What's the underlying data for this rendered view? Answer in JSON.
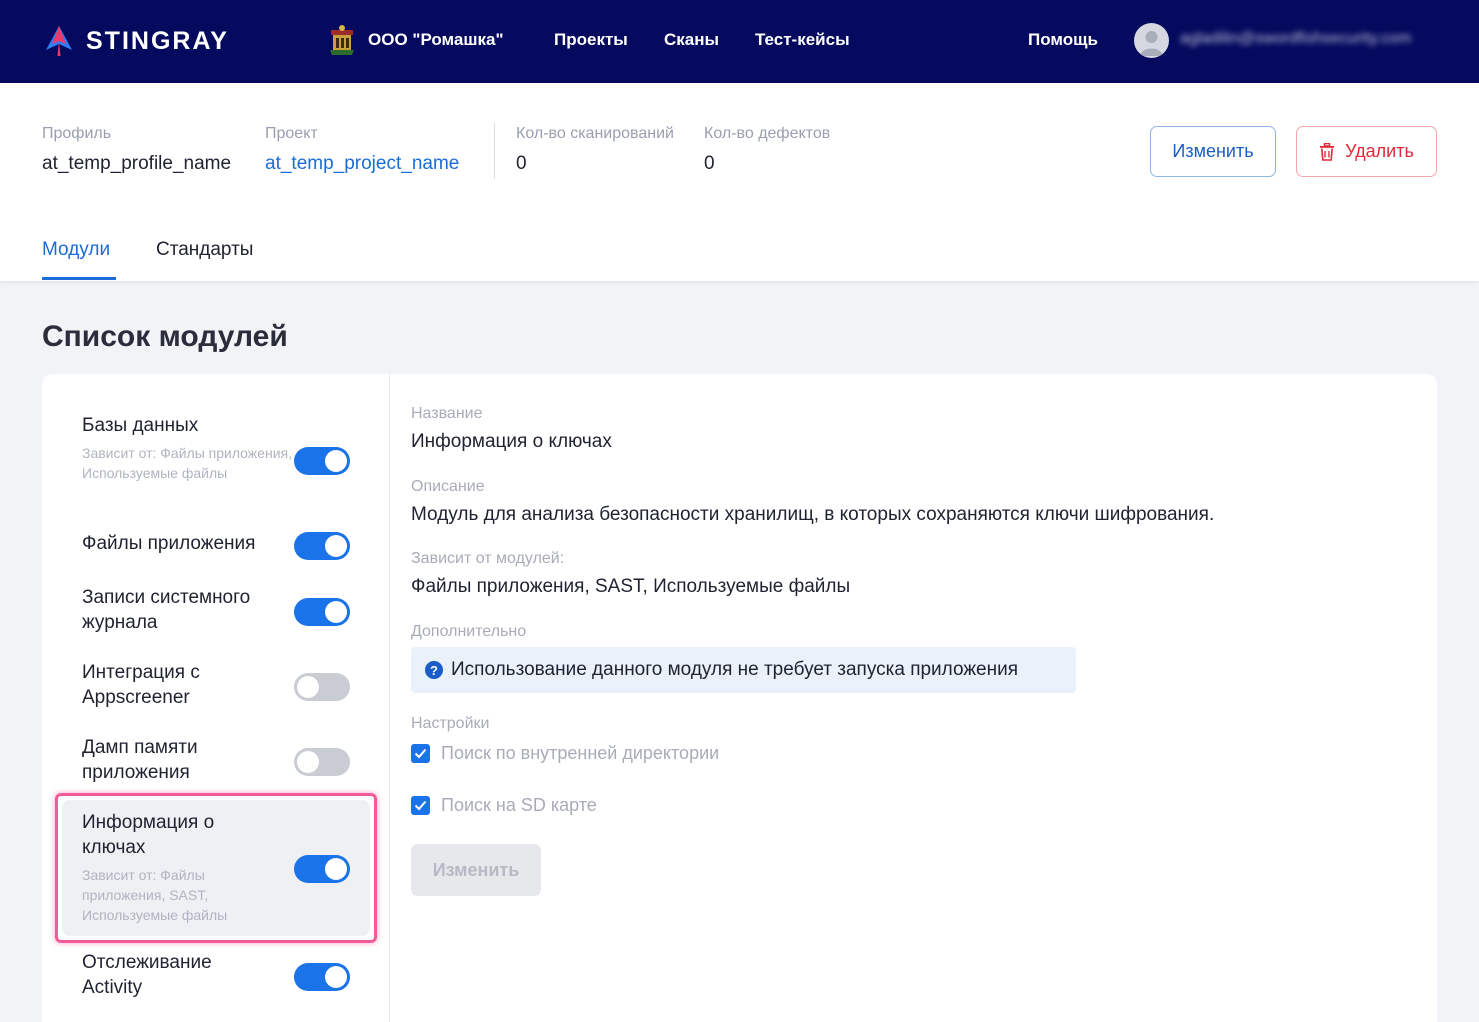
{
  "nav": {
    "brand": "STINGRAY",
    "org": "ООО \"Ромашка\"",
    "links": [
      "Проекты",
      "Сканы",
      "Тест-кейсы"
    ],
    "help": "Помощь",
    "email": "agladilin@swordfishsecurity.com"
  },
  "header": {
    "profile_label": "Профиль",
    "profile_value": "at_temp_profile_name",
    "project_label": "Проект",
    "project_value": "at_temp_project_name",
    "scans_label": "Кол-во сканирований",
    "scans_value": "0",
    "defects_label": "Кол-во дефектов",
    "defects_value": "0",
    "edit_label": "Изменить",
    "delete_label": "Удалить",
    "tabs": [
      "Модули",
      "Стандарты"
    ],
    "active_tab": "Модули"
  },
  "section_title": "Список модулей",
  "modules": [
    {
      "name": "Базы данных",
      "dep": "Зависит от:  Файлы приложения, Используемые файлы",
      "enabled": true
    },
    {
      "name": "Файлы приложения",
      "dep": "",
      "enabled": true
    },
    {
      "name": "Записи системного журнала",
      "dep": "",
      "enabled": true
    },
    {
      "name": "Интеграция с Appscreener",
      "dep": "",
      "enabled": false
    },
    {
      "name": "Дамп памяти приложения",
      "dep": "",
      "enabled": false
    },
    {
      "name": "Информация о ключах",
      "dep": "Зависит от:  Файлы приложения, SAST, Используемые файлы",
      "enabled": true,
      "selected": true
    },
    {
      "name": "Отслеживание Activity",
      "dep": "",
      "enabled": true
    }
  ],
  "details": {
    "name_label": "Название",
    "name_value": "Информация о ключах",
    "desc_label": "Описание",
    "desc_value": "Модуль для анализа безопасности хранилищ, в которых сохраняются ключи шифрования.",
    "deps_label": "Зависит от модулей:",
    "deps_value": "Файлы приложения, SAST, Используемые файлы",
    "extra_label": "Дополнительно",
    "extra_value": "Использование данного модуля не требует запуска приложения",
    "settings_label": "Настройки",
    "settings": [
      {
        "label": "Поиск по внутренней директории",
        "checked": true
      },
      {
        "label": "Поиск на SD карте",
        "checked": true
      }
    ],
    "submit_label": "Изменить"
  }
}
